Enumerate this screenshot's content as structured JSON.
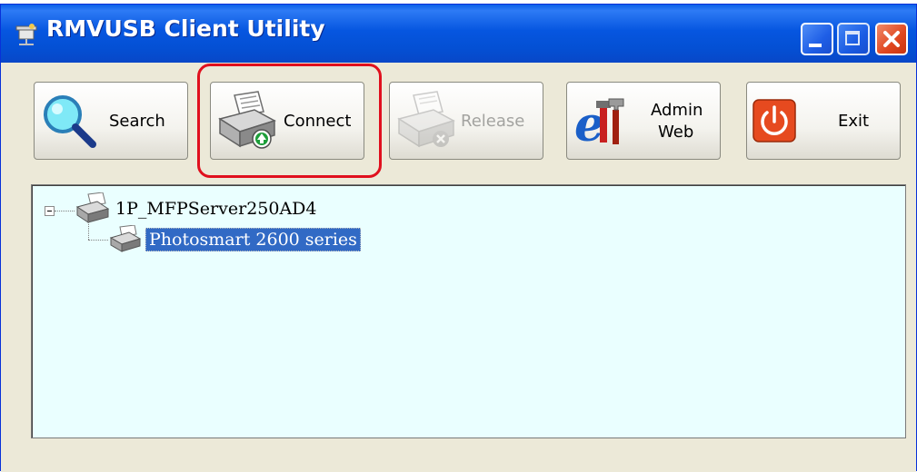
{
  "window": {
    "title": "RMVUSB Client Utility",
    "title_bar_color": "#0656e0",
    "close_color": "#e0461f"
  },
  "toolbar": {
    "search_label": "Search",
    "connect_label": "Connect",
    "release_label": "Release",
    "admin_label_line1": "Admin",
    "admin_label_line2": "Web",
    "exit_label": "Exit",
    "release_enabled": false,
    "highlight_color": "#e0101e",
    "highlighted_button": "connect"
  },
  "tree": {
    "background": "#eaffff",
    "server": {
      "label": "1P_MFPServer250AD4",
      "icon": "server-printer-icon",
      "expanded": true
    },
    "printer": {
      "label": "Photosmart 2600 series",
      "icon": "printer-icon",
      "selected": true
    }
  },
  "icons": {
    "search": "magnifier-icon",
    "connect": "printer-connect-icon",
    "release": "printer-release-icon",
    "admin": "ie-tools-icon",
    "exit": "power-icon"
  }
}
